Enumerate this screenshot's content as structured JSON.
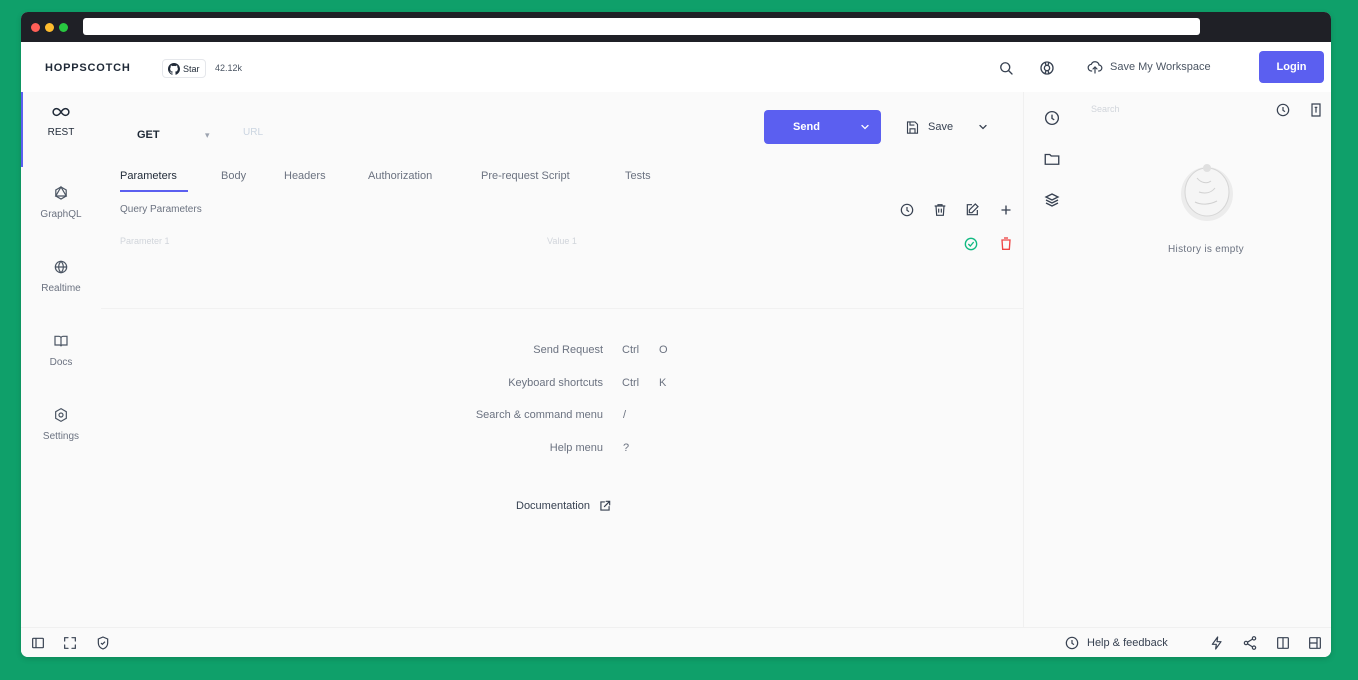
{
  "app": {
    "brand": "HOPPSCOTCH"
  },
  "github": {
    "star_label": "Star",
    "star_count": "42.12k"
  },
  "header": {
    "save_workspace_label": "Save My Workspace",
    "login_label": "Login"
  },
  "nav": [
    {
      "label": "REST",
      "icon": "infinity-icon",
      "active": true
    },
    {
      "label": "GraphQL",
      "icon": "graphql-icon"
    },
    {
      "label": "Realtime",
      "icon": "globe-icon"
    },
    {
      "label": "Docs",
      "icon": "book-icon"
    },
    {
      "label": "Settings",
      "icon": "settings-icon"
    }
  ],
  "request": {
    "method": "GET",
    "url_placeholder": "URL",
    "send_label": "Send",
    "save_label": "Save"
  },
  "tabs": [
    "Parameters",
    "Body",
    "Headers",
    "Authorization",
    "Pre-request Script",
    "Tests"
  ],
  "active_tab": "Parameters",
  "query": {
    "title": "Query Parameters",
    "param_placeholder": "Parameter 1",
    "value_placeholder": "Value 1"
  },
  "shortcuts": [
    {
      "label": "Send Request",
      "keys": [
        "Ctrl",
        "O"
      ]
    },
    {
      "label": "Keyboard shortcuts",
      "keys": [
        "Ctrl",
        "K"
      ]
    },
    {
      "label": "Search & command menu",
      "keys": [
        "/"
      ]
    },
    {
      "label": "Help menu",
      "keys": [
        "?"
      ]
    }
  ],
  "documentation_label": "Documentation",
  "sidebar": {
    "search_placeholder": "Search",
    "history_empty": "History is empty"
  },
  "footer": {
    "help_label": "Help & feedback"
  },
  "colors": {
    "accent": "#5b5ff0",
    "frame": "#0fa06a",
    "success": "#10b981",
    "danger": "#ef4444"
  }
}
